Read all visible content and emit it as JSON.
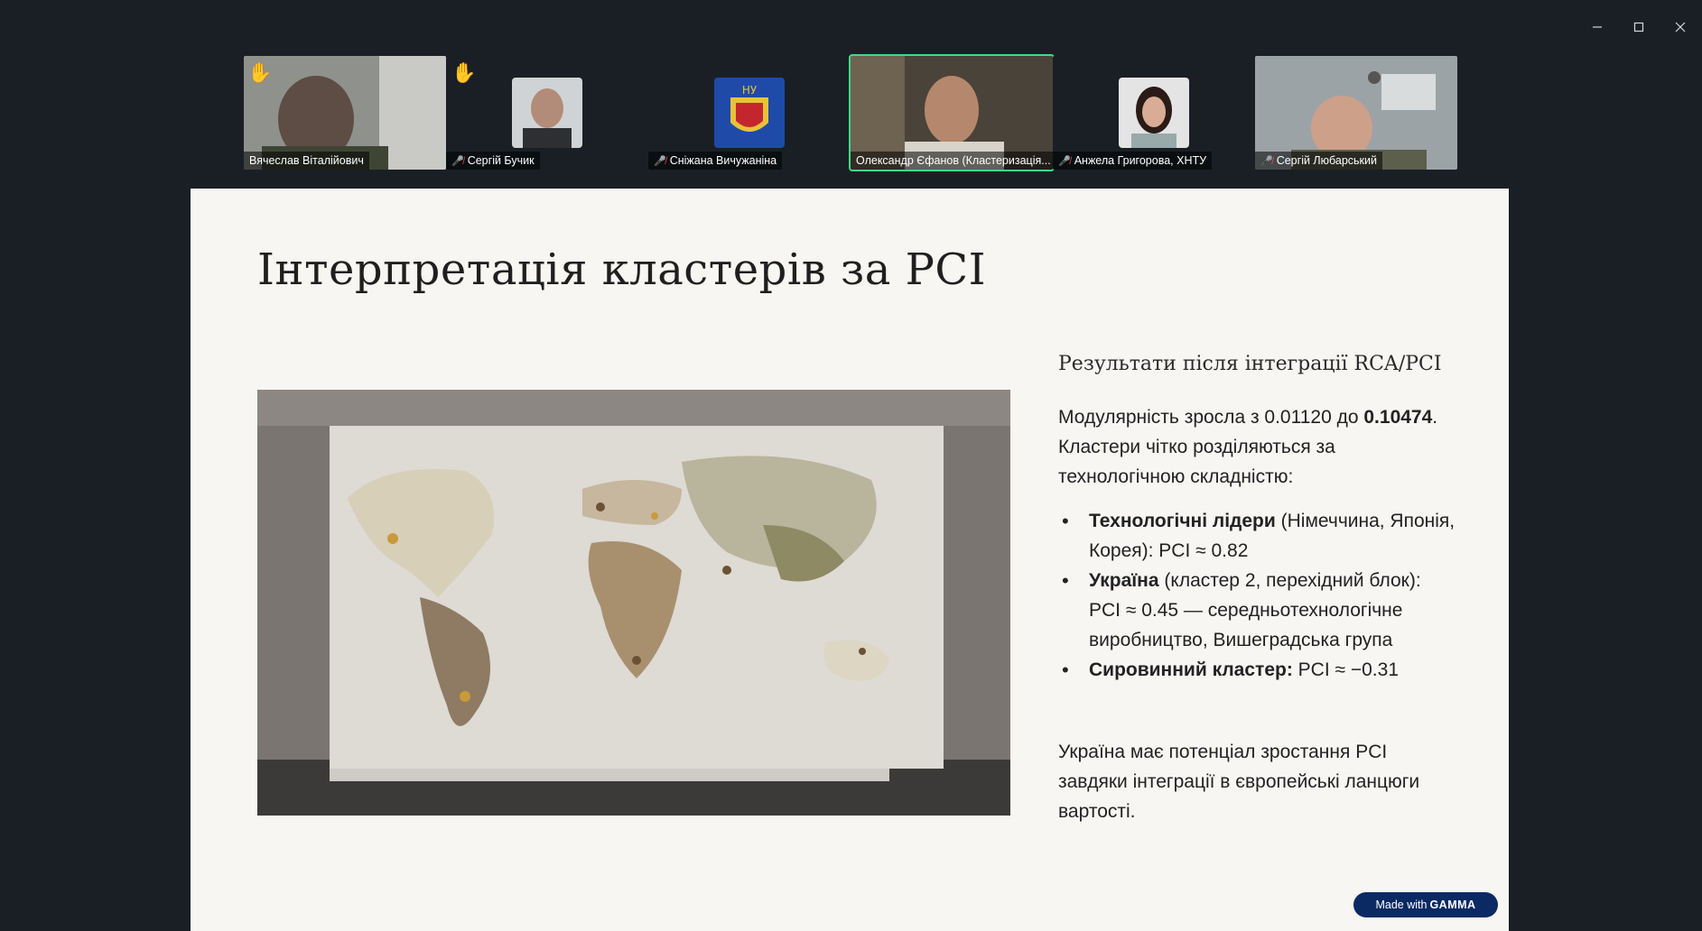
{
  "window": {
    "minimize_icon": "minimize-icon",
    "maximize_icon": "maximize-icon",
    "close_icon": "close-icon"
  },
  "participants": [
    {
      "name": "Вячеслав Віталійович",
      "muted": false,
      "hand_raised": true,
      "video": true
    },
    {
      "name": "Сергій Бучик",
      "muted": true,
      "hand_raised": true,
      "video": false
    },
    {
      "name": "Сніжана Вичужаніна",
      "muted": true,
      "hand_raised": false,
      "video": false
    },
    {
      "name": "Олександр Єфанов (Кластеризація...",
      "muted": false,
      "hand_raised": false,
      "video": true,
      "active_speaker": true
    },
    {
      "name": "Анжела Григорова, ХНТУ",
      "muted": true,
      "hand_raised": false,
      "video": false
    },
    {
      "name": "Сергій Любарський",
      "muted": true,
      "hand_raised": false,
      "video": true
    }
  ],
  "slide": {
    "title": "Інтерпретація кластерів за PCI",
    "subtitle": "Результати після інтеграції RCA/PCI",
    "para_pre": "Модулярність зросла з 0.01120 до ",
    "para_bold": "0.10474",
    "para_post": ". Кластери чітко розділяються за технологічною складністю:",
    "bullets": [
      {
        "bold": "Технологічні лідери",
        "text": " (Німеччина, Японія, Корея): PCI ≈ 0.82"
      },
      {
        "bold": "Україна",
        "text": " (кластер 2, перехідний блок): PCI ≈ 0.45 — середньотехнологічне виробництво, Вишеградська група"
      },
      {
        "bold": "Сировинний кластер:",
        "text": " PCI ≈ −0.31"
      }
    ],
    "final": "Україна має потенціал зростання PCI завдяки інтеграції в європейські ланцюги вартості.",
    "badge_pre": "Made with",
    "badge_brand": "GAMMA"
  },
  "colors": {
    "background": "#1a1f26",
    "slide_bg": "#f8f6f3",
    "active_border": "#3ddc84",
    "badge": "#0b2a63",
    "mute": "#e5484d"
  }
}
